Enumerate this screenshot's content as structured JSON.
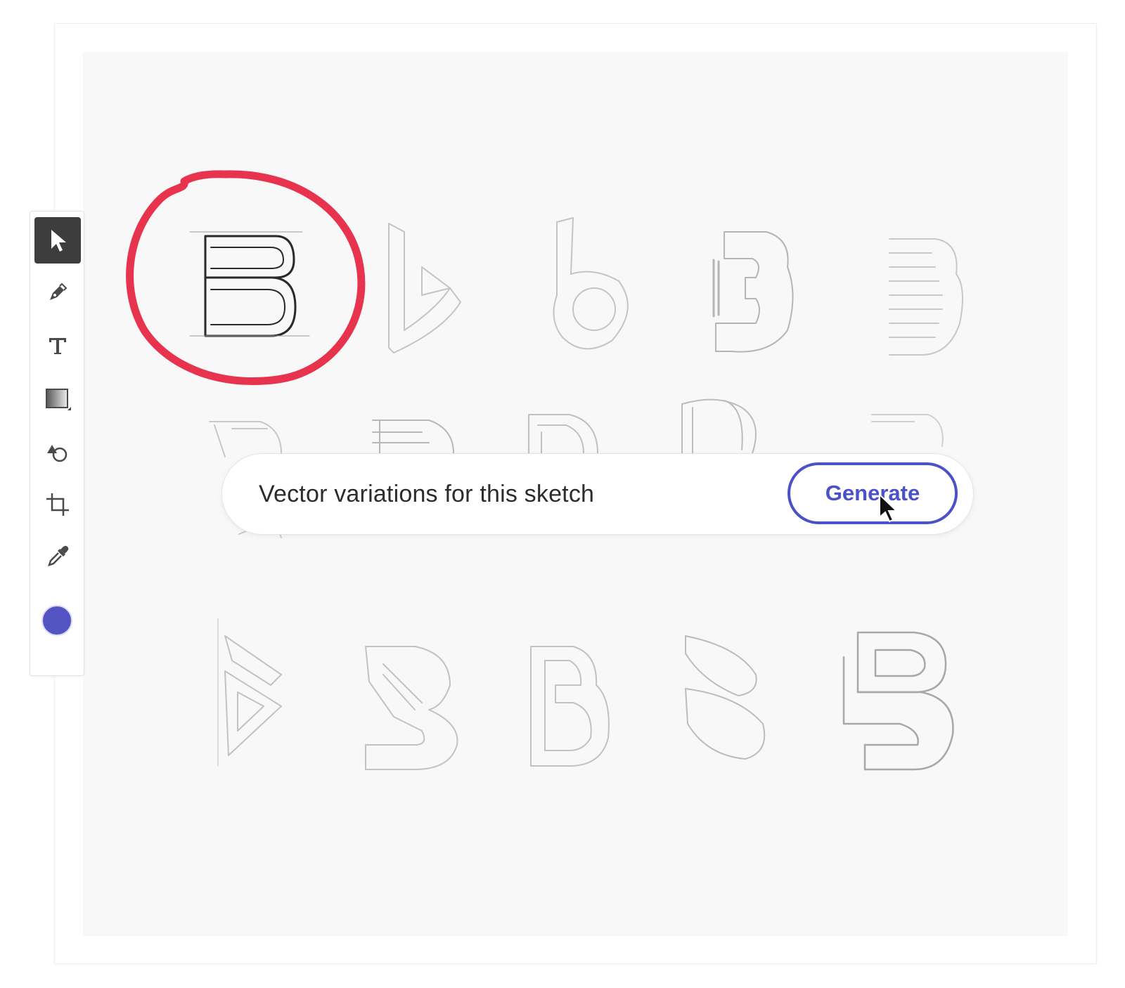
{
  "toolbar": {
    "tools": [
      {
        "id": "selection",
        "icon": "selection-arrow-icon",
        "active": true
      },
      {
        "id": "pen",
        "icon": "pen-icon",
        "active": false
      },
      {
        "id": "type",
        "icon": "type-icon",
        "active": false
      },
      {
        "id": "gradient",
        "icon": "gradient-icon",
        "active": false
      },
      {
        "id": "shape",
        "icon": "shape-icon",
        "active": false
      },
      {
        "id": "artboard",
        "icon": "artboard-icon",
        "active": false
      },
      {
        "id": "eyedropper",
        "icon": "eyedropper-icon",
        "active": false
      }
    ],
    "fill_color": "#5453c2"
  },
  "canvas": {
    "sketch_count": 15,
    "selected_sketch": 1,
    "highlight_color": "#e8334f"
  },
  "prompt": {
    "text": "Vector variations for this sketch",
    "button_label": "Generate",
    "accent_color": "#4b52c8"
  }
}
